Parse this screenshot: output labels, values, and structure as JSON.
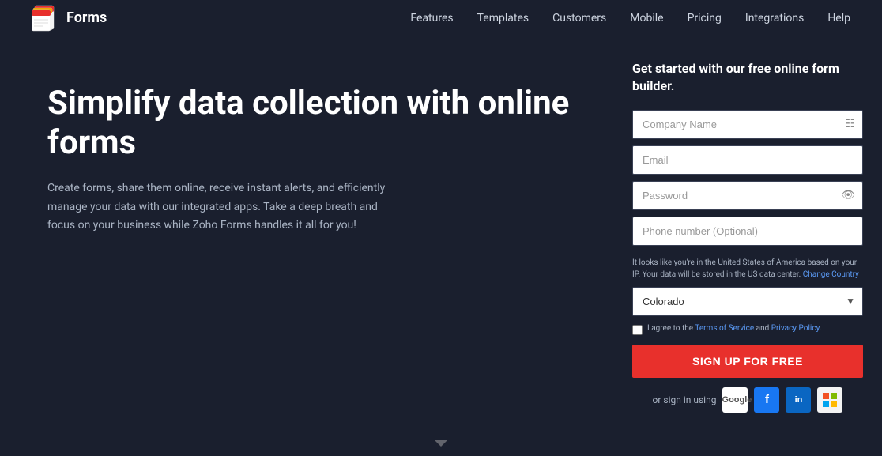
{
  "header": {
    "logo_text": "Forms",
    "nav": [
      {
        "label": "Features",
        "id": "features"
      },
      {
        "label": "Templates",
        "id": "templates"
      },
      {
        "label": "Customers",
        "id": "customers"
      },
      {
        "label": "Mobile",
        "id": "mobile"
      },
      {
        "label": "Pricing",
        "id": "pricing"
      },
      {
        "label": "Integrations",
        "id": "integrations"
      },
      {
        "label": "Help",
        "id": "help"
      }
    ]
  },
  "hero": {
    "title": "Simplify data collection with online forms",
    "subtitle": "Create forms, share them online, receive instant alerts, and efficiently manage your data with our integrated apps. Take a deep breath and focus on your business while Zoho Forms handles it all for you!"
  },
  "form": {
    "title": "Get started with our free online form builder.",
    "fields": {
      "company_placeholder": "Company Name",
      "email_placeholder": "Email",
      "password_placeholder": "Password",
      "phone_placeholder": "Phone number (Optional)"
    },
    "geo_notice": "It looks like you're in the United States of America based on your IP. Your data will be stored in the US data center.",
    "change_country_link": "Change Country",
    "country_selected": "Colorado",
    "tos_text": "I agree to the",
    "tos_link1": "Terms of Service",
    "tos_and": "and",
    "tos_link2": "Privacy Policy",
    "tos_period": ".",
    "signup_label": "SIGN UP FOR FREE",
    "signin_label": "or sign in using",
    "google_label": "Google",
    "social_icons": {
      "google": "G",
      "facebook": "f",
      "linkedin": "in",
      "microsoft": "⬛"
    }
  }
}
